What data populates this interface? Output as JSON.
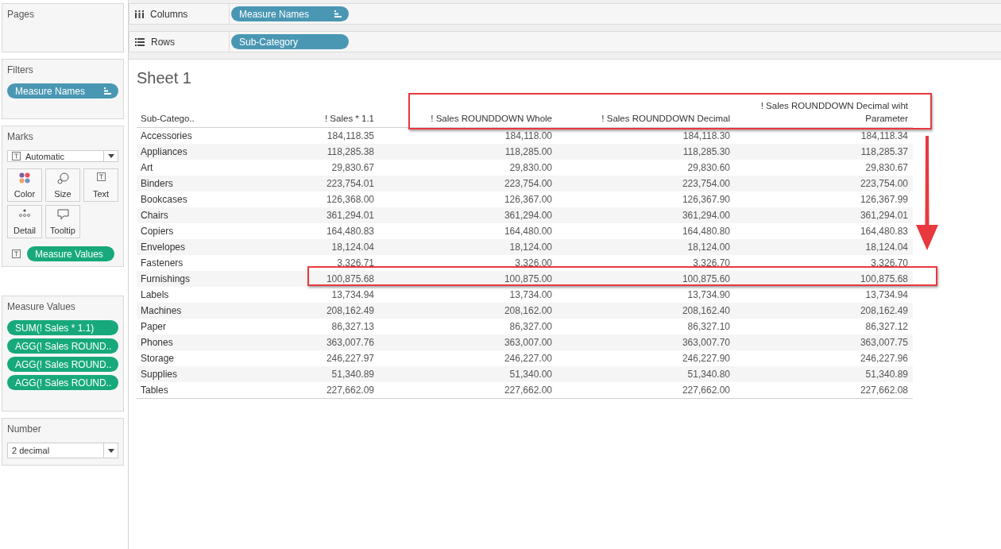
{
  "pages": {
    "title": "Pages"
  },
  "filters": {
    "title": "Filters",
    "pills": [
      {
        "label": "Measure Names",
        "kind": "dimension",
        "sort_icon": true
      }
    ]
  },
  "marks": {
    "title": "Marks",
    "mark_type": "Automatic",
    "cards": [
      {
        "label": "Color",
        "kind": "color"
      },
      {
        "label": "Size",
        "kind": "size"
      },
      {
        "label": "Text",
        "kind": "text"
      },
      {
        "label": "Detail",
        "kind": "detail"
      },
      {
        "label": "Tooltip",
        "kind": "tooltip"
      }
    ],
    "encodings": [
      {
        "label": "Measure Values",
        "kind": "measure"
      }
    ]
  },
  "measure_values": {
    "title": "Measure Values",
    "pills": [
      {
        "label": "SUM(! Sales * 1.1)",
        "kind": "measure"
      },
      {
        "label": "AGG(! Sales ROUND..",
        "kind": "measure"
      },
      {
        "label": "AGG(! Sales ROUND..",
        "kind": "measure"
      },
      {
        "label": "AGG(! Sales ROUND..",
        "kind": "measure"
      }
    ]
  },
  "number": {
    "title": "Number",
    "value": "2 decimal"
  },
  "shelves": [
    {
      "label": "Columns",
      "kind": "columns",
      "pills": [
        {
          "label": "Measure Names",
          "kind": "dimension",
          "sort_icon": true
        }
      ]
    },
    {
      "label": "Rows",
      "kind": "rows",
      "pills": [
        {
          "label": "Sub-Category",
          "kind": "dimension",
          "sort_icon": false
        }
      ]
    }
  ],
  "sheet": {
    "title": "Sheet 1",
    "pointer_arrow": true,
    "table": {
      "columns": [
        {
          "label": "Sub-Catego..",
          "highlighted": false
        },
        {
          "label": "! Sales * 1.1",
          "highlighted": false
        },
        {
          "label": "! Sales ROUNDDOWN Whole",
          "highlighted": true
        },
        {
          "label": "! Sales ROUNDDOWN Decimal",
          "highlighted": true
        },
        {
          "label": "! Sales ROUNDDOWN Decimal wiht Parameter",
          "highlighted": true
        }
      ],
      "rows": [
        {
          "cells": [
            "Accessories",
            "184,118.35",
            "184,118.00",
            "184,118.30",
            "184,118.34"
          ],
          "highlighted": false
        },
        {
          "cells": [
            "Appliances",
            "118,285.38",
            "118,285.00",
            "118,285.30",
            "118,285.37"
          ],
          "highlighted": false
        },
        {
          "cells": [
            "Art",
            "29,830.67",
            "29,830.00",
            "29,830.60",
            "29,830.67"
          ],
          "highlighted": false
        },
        {
          "cells": [
            "Binders",
            "223,754.01",
            "223,754.00",
            "223,754.00",
            "223,754.00"
          ],
          "highlighted": false
        },
        {
          "cells": [
            "Bookcases",
            "126,368.00",
            "126,367.00",
            "126,367.90",
            "126,367.99"
          ],
          "highlighted": false
        },
        {
          "cells": [
            "Chairs",
            "361,294.01",
            "361,294.00",
            "361,294.00",
            "361,294.01"
          ],
          "highlighted": false
        },
        {
          "cells": [
            "Copiers",
            "164,480.83",
            "164,480.00",
            "164,480.80",
            "164,480.83"
          ],
          "highlighted": false
        },
        {
          "cells": [
            "Envelopes",
            "18,124.04",
            "18,124.00",
            "18,124.00",
            "18,124.04"
          ],
          "highlighted": false
        },
        {
          "cells": [
            "Fasteners",
            "3,326.71",
            "3,326.00",
            "3,326.70",
            "3,326.70"
          ],
          "highlighted": false
        },
        {
          "cells": [
            "Furnishings",
            "100,875.68",
            "100,875.00",
            "100,875.60",
            "100,875.68"
          ],
          "highlighted": true
        },
        {
          "cells": [
            "Labels",
            "13,734.94",
            "13,734.00",
            "13,734.90",
            "13,734.94"
          ],
          "highlighted": false
        },
        {
          "cells": [
            "Machines",
            "208,162.49",
            "208,162.00",
            "208,162.40",
            "208,162.49"
          ],
          "highlighted": false
        },
        {
          "cells": [
            "Paper",
            "86,327.13",
            "86,327.00",
            "86,327.10",
            "86,327.12"
          ],
          "highlighted": false
        },
        {
          "cells": [
            "Phones",
            "363,007.76",
            "363,007.00",
            "363,007.70",
            "363,007.75"
          ],
          "highlighted": false
        },
        {
          "cells": [
            "Storage",
            "246,227.97",
            "246,227.00",
            "246,227.90",
            "246,227.96"
          ],
          "highlighted": false
        },
        {
          "cells": [
            "Supplies",
            "51,340.89",
            "51,340.00",
            "51,340.80",
            "51,340.89"
          ],
          "highlighted": false
        },
        {
          "cells": [
            "Tables",
            "227,662.09",
            "227,662.00",
            "227,662.00",
            "227,662.08"
          ],
          "highlighted": false
        }
      ]
    }
  }
}
